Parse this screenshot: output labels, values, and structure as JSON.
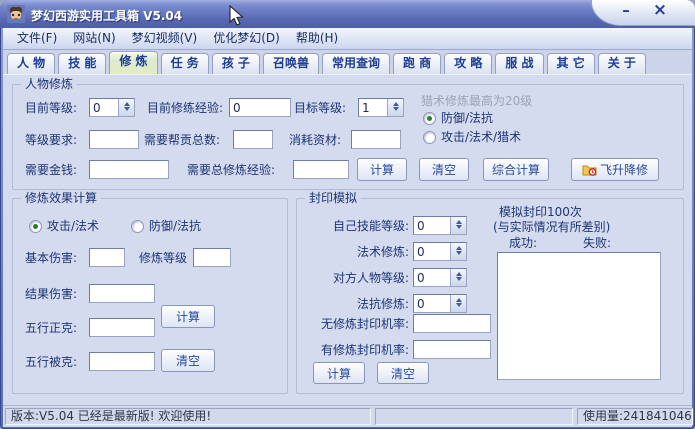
{
  "window": {
    "title": "梦幻西游实用工具箱 V5.04",
    "minimize_label": "–",
    "close_label": "×"
  },
  "menubar": {
    "items": [
      "文件(F)",
      "网站(N)",
      "梦幻视频(V)",
      "优化梦幻(D)",
      "帮助(H)"
    ]
  },
  "tabs": {
    "items": [
      {
        "label": "人 物",
        "active": false
      },
      {
        "label": "技 能",
        "active": false
      },
      {
        "label": "修 炼",
        "active": true
      },
      {
        "label": "任 务",
        "active": false
      },
      {
        "label": "孩 子",
        "active": false
      },
      {
        "label": "召唤兽",
        "active": false
      },
      {
        "label": "常用查询",
        "active": false
      },
      {
        "label": "跑 商",
        "active": false
      },
      {
        "label": "攻 略",
        "active": false
      },
      {
        "label": "服 战",
        "active": false
      },
      {
        "label": "其 它",
        "active": false
      },
      {
        "label": "关 于",
        "active": false
      }
    ]
  },
  "cultivation": {
    "title": "人物修炼",
    "current_level_label": "目前等级:",
    "current_level_value": "0",
    "current_exp_label": "目前修练经验:",
    "current_exp_value": "0",
    "target_level_label": "目标等级:",
    "target_level_value": "1",
    "hint": "猎术修炼最高为20级",
    "radio_defense_label": "防御/法抗",
    "radio_defense_selected": true,
    "radio_attack_label": "攻击/法术/猎术",
    "radio_attack_selected": false,
    "level_req_label": "等级要求:",
    "gang_points_label": "需要帮贡总数:",
    "material_label": "消耗资材:",
    "money_label": "需要金钱:",
    "total_exp_label": "需要总修炼经验:",
    "calc_label": "计算",
    "clear_label": "清空",
    "combo_calc_label": "综合计算",
    "fly_label": "飞升降修"
  },
  "effect": {
    "title": "修炼效果计算",
    "radio_attack_label": "攻击/法术",
    "radio_attack_selected": true,
    "radio_defense_label": "防御/法抗",
    "radio_defense_selected": false,
    "base_damage_label": "基本伤害:",
    "cultivation_level_label": "修炼等级",
    "result_damage_label": "结果伤害:",
    "wuxing_strong_label": "五行正克:",
    "wuxing_weak_label": "五行被克:",
    "calc_label": "计算",
    "clear_label": "清空"
  },
  "seal": {
    "title": "封印模拟",
    "self_skill_label": "自己技能等级:",
    "self_skill_value": "0",
    "magic_cult_label": "法术修炼:",
    "magic_cult_value": "0",
    "target_level_label": "对方人物等级:",
    "target_level_value": "0",
    "resist_cult_label": "法抗修炼:",
    "resist_cult_value": "0",
    "no_cult_rate_label": "无修炼封印机率:",
    "with_cult_rate_label": "有修炼封印机率:",
    "calc_label": "计算",
    "clear_label": "清空",
    "sim_title": "模拟封印100次",
    "sim_note": "(与实际情况有所差别)",
    "success_label": "成功:",
    "fail_label": "失败:"
  },
  "statusbar": {
    "version_text": "版本:V5.04 已经是最新版! 欢迎使用!",
    "usage_text": "使用量:241841046"
  },
  "colors": {
    "titlebar": "#5668b2",
    "content_bg": "#d5dbee",
    "active_tab": "#e8f0c8",
    "label_text": "#1d3576",
    "radio_dot": "#2f7d2f"
  }
}
